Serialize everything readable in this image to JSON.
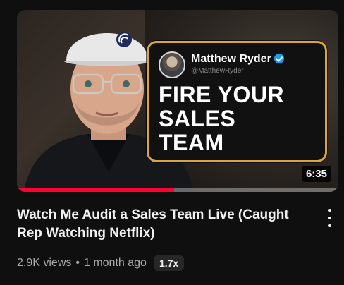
{
  "video": {
    "thumbnail": {
      "channel_name": "Matthew Ryder",
      "channel_handle": "@MatthewRyder",
      "verified_icon": "verified-check-icon",
      "headline_lines": [
        "FIRE YOUR",
        "SALES",
        "TEAM"
      ],
      "duration": "6:35",
      "watch_progress_percent": 49,
      "colors": {
        "card_border": "#d9a441",
        "progress": "#ff0033",
        "verified": "#1d9bf0"
      }
    },
    "title": "Watch Me Audit a Sales Team Live (Caught Rep Watching Netflix)",
    "views": "2.9K views",
    "separator": "•",
    "age": "1 month ago",
    "speed_badge": "1.7x",
    "menu_icon": "more-vertical-icon"
  }
}
